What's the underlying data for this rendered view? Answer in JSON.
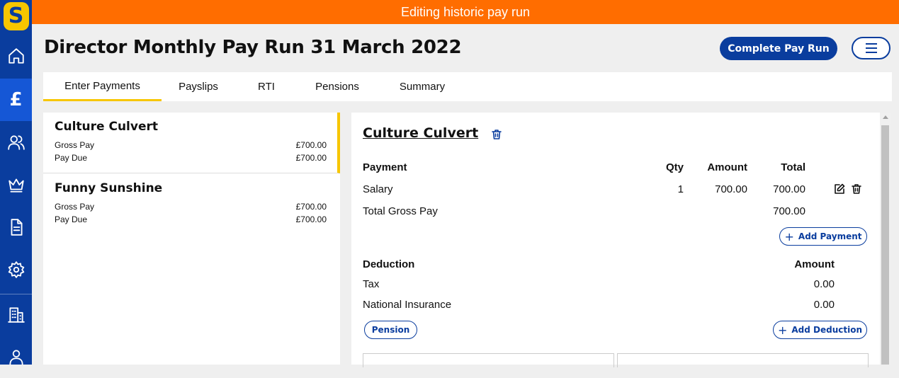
{
  "sidebar": {
    "logo_letter": "S",
    "icons": [
      "home-icon",
      "pound-icon",
      "people-icon",
      "crown-icon",
      "document-icon",
      "settings-icon",
      "building-icon",
      "user-icon"
    ],
    "pound_glyph": "£"
  },
  "banner": {
    "text": "Editing historic pay run"
  },
  "header": {
    "title": "Director Monthly Pay Run 31 March 2022",
    "complete_button": "Complete Pay Run"
  },
  "tabs": [
    "Enter Payments",
    "Payslips",
    "RTI",
    "Pensions",
    "Summary"
  ],
  "employees": [
    {
      "name": "Culture Culvert",
      "gross_label": "Gross Pay",
      "gross": "£700.00",
      "due_label": "Pay Due",
      "due": "£700.00"
    },
    {
      "name": "Funny Sunshine",
      "gross_label": "Gross Pay",
      "gross": "£700.00",
      "due_label": "Pay Due",
      "due": "£700.00"
    }
  ],
  "detail": {
    "employee_name": "Culture Culvert",
    "payment_headers": {
      "payment": "Payment",
      "qty": "Qty",
      "amount": "Amount",
      "total": "Total"
    },
    "payments": [
      {
        "name": "Salary",
        "qty": "1",
        "amount": "700.00",
        "total": "700.00"
      }
    ],
    "total_gross_label": "Total Gross Pay",
    "total_gross": "700.00",
    "add_payment": "Add Payment",
    "deduction_headers": {
      "deduction": "Deduction",
      "amount": "Amount"
    },
    "deductions": [
      {
        "name": "Tax",
        "amount": "0.00"
      },
      {
        "name": "National Insurance",
        "amount": "0.00"
      }
    ],
    "pension_button": "Pension",
    "add_deduction": "Add Deduction"
  }
}
